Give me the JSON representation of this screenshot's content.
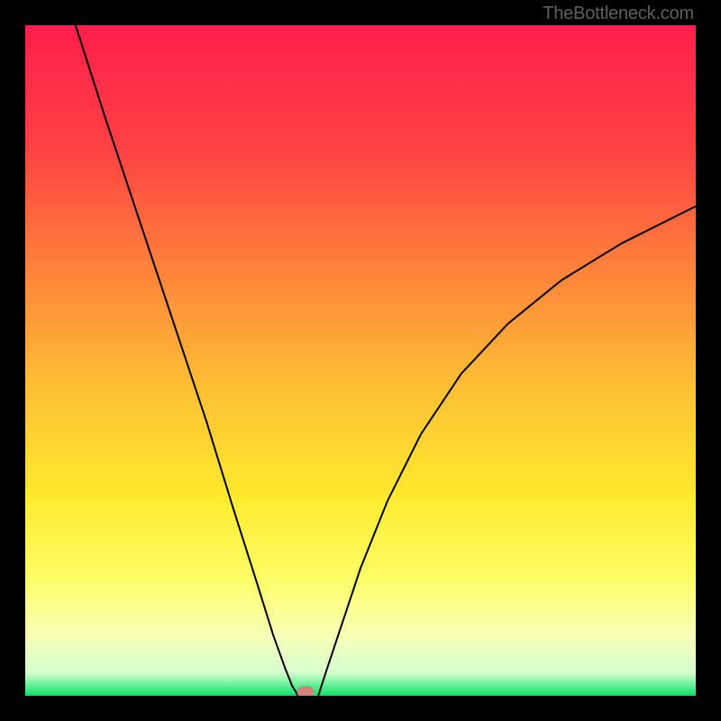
{
  "watermark": "TheBottleneck.com",
  "chart_data": {
    "type": "line",
    "title": "",
    "xlabel": "",
    "ylabel": "",
    "xlim": [
      0,
      1
    ],
    "ylim": [
      0,
      1
    ],
    "gradient_stops": [
      {
        "offset": 0.0,
        "color": "#ff1f4c"
      },
      {
        "offset": 0.18,
        "color": "#ff4044"
      },
      {
        "offset": 0.36,
        "color": "#ff813b"
      },
      {
        "offset": 0.54,
        "color": "#ffbf34"
      },
      {
        "offset": 0.7,
        "color": "#ffe92e"
      },
      {
        "offset": 0.82,
        "color": "#fdfd63"
      },
      {
        "offset": 0.91,
        "color": "#f8ffb6"
      },
      {
        "offset": 0.965,
        "color": "#d6ffcf"
      },
      {
        "offset": 1.0,
        "color": "#09e36a"
      }
    ],
    "series": [
      {
        "name": "left-branch",
        "x": [
          0.075,
          0.12,
          0.17,
          0.22,
          0.27,
          0.31,
          0.345,
          0.37,
          0.388,
          0.398,
          0.404,
          0.407
        ],
        "y": [
          1.0,
          0.86,
          0.71,
          0.56,
          0.41,
          0.28,
          0.17,
          0.09,
          0.04,
          0.015,
          0.005,
          0.0
        ]
      },
      {
        "name": "right-branch",
        "x": [
          0.437,
          0.45,
          0.47,
          0.5,
          0.54,
          0.59,
          0.65,
          0.72,
          0.8,
          0.89,
          1.0
        ],
        "y": [
          0.0,
          0.04,
          0.1,
          0.19,
          0.29,
          0.39,
          0.48,
          0.555,
          0.62,
          0.675,
          0.73
        ]
      }
    ],
    "marker": {
      "x": 0.418,
      "y": 0.006,
      "rx": 0.013,
      "ry": 0.009,
      "color": "#cf847e"
    }
  }
}
